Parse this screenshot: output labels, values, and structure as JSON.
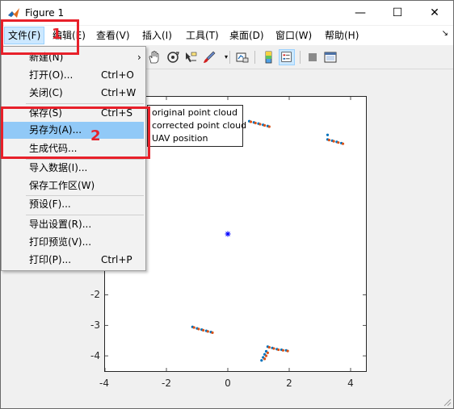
{
  "window": {
    "title": "Figure 1",
    "minimize_glyph": "—",
    "maximize_glyph": "☐",
    "close_glyph": "✕"
  },
  "menubar": {
    "items": [
      {
        "label": "文件(F)"
      },
      {
        "label": "编辑(E)"
      },
      {
        "label": "查看(V)"
      },
      {
        "label": "插入(I)"
      },
      {
        "label": "工具(T)"
      },
      {
        "label": "桌面(D)"
      },
      {
        "label": "窗口(W)"
      },
      {
        "label": "帮助(H)"
      }
    ],
    "extra_glyph": "↘"
  },
  "file_menu": {
    "items": [
      {
        "label": "新建(N)",
        "shortcut": "",
        "submenu": true
      },
      {
        "label": "打开(O)...",
        "shortcut": "Ctrl+O"
      },
      {
        "label": "关闭(C)",
        "shortcut": "Ctrl+W"
      },
      {
        "label": "保存(S)",
        "shortcut": "Ctrl+S"
      },
      {
        "label": "另存为(A)...",
        "shortcut": "",
        "highlighted": true
      },
      {
        "label": "生成代码...",
        "shortcut": ""
      },
      {
        "label": "导入数据(I)...",
        "shortcut": ""
      },
      {
        "label": "保存工作区(W)",
        "shortcut": ""
      },
      {
        "label": "预设(F)...",
        "shortcut": ""
      },
      {
        "label": "导出设置(R)...",
        "shortcut": ""
      },
      {
        "label": "打印预览(V)...",
        "shortcut": ""
      },
      {
        "label": "打印(P)...",
        "shortcut": "Ctrl+P"
      }
    ],
    "submenu_glyph": "›"
  },
  "annotations": {
    "label_1": "1",
    "label_2": "2",
    "color": "#e8202a"
  },
  "chart_data": {
    "type": "scatter",
    "xlim": [
      -4,
      4.5
    ],
    "ylim": [
      -4.5,
      4.5
    ],
    "xticks": [
      "-4",
      "-2",
      "0",
      "2",
      "4"
    ],
    "yticks": [
      "-2",
      "-3",
      "-4"
    ],
    "legend": {
      "placement": "top-left",
      "entries": [
        "original point cloud",
        "corrected point cloud",
        "UAV position"
      ]
    },
    "series": [
      {
        "name": "original point cloud",
        "color": "#0072bd",
        "marker": "dot",
        "x": [
          0.7,
          0.85,
          1.0,
          1.15,
          1.3,
          3.25,
          3.4,
          3.55,
          3.7,
          3.25,
          -1.15,
          -1.0,
          -0.85,
          -0.7,
          -0.55,
          1.3,
          1.45,
          1.6,
          1.75,
          1.9,
          1.25,
          1.2,
          1.15,
          1.1
        ],
        "y": [
          3.7,
          3.66,
          3.62,
          3.58,
          3.54,
          3.1,
          3.06,
          3.02,
          2.98,
          3.25,
          -3.05,
          -3.1,
          -3.14,
          -3.18,
          -3.22,
          -3.7,
          -3.74,
          -3.78,
          -3.8,
          -3.82,
          -3.85,
          -3.95,
          -4.05,
          -4.15
        ]
      },
      {
        "name": "corrected point cloud",
        "color": "#d95319",
        "marker": "dot",
        "x": [
          0.75,
          0.9,
          1.05,
          1.2,
          1.35,
          3.3,
          3.45,
          3.6,
          3.75,
          -1.1,
          -0.95,
          -0.8,
          -0.65,
          -0.5,
          1.35,
          1.5,
          1.65,
          1.8,
          1.95,
          1.3,
          1.25,
          1.2
        ],
        "y": [
          3.68,
          3.64,
          3.6,
          3.56,
          3.52,
          3.08,
          3.04,
          3.0,
          2.96,
          -3.07,
          -3.12,
          -3.16,
          -3.2,
          -3.24,
          -3.72,
          -3.76,
          -3.8,
          -3.82,
          -3.84,
          -3.9,
          -4.0,
          -4.1
        ]
      },
      {
        "name": "UAV position",
        "color": "#0000ff",
        "marker": "asterisk",
        "x": [
          0
        ],
        "y": [
          0
        ]
      }
    ]
  }
}
